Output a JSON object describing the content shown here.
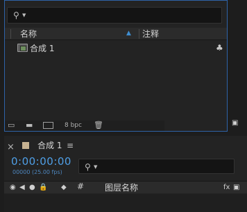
{
  "project_panel": {
    "search": {
      "placeholder": ""
    },
    "columns": {
      "name": "名称",
      "comment": "注释"
    },
    "items": [
      {
        "name": "合成 1"
      }
    ],
    "footer": {
      "bit_depth": "8 bpc"
    }
  },
  "timeline": {
    "tab_title": "合成 1",
    "timecode": "0:00:00:00",
    "timecode_sub": "00000 (25.00 fps)",
    "search": {
      "placeholder": ""
    },
    "columns": {
      "layer_name": "图层名称",
      "number": "#",
      "fx": "fx"
    }
  },
  "colors": {
    "accent_blue": "#4f9fe6",
    "panel_border": "#2e63a8",
    "swatch": "#c7b291"
  }
}
